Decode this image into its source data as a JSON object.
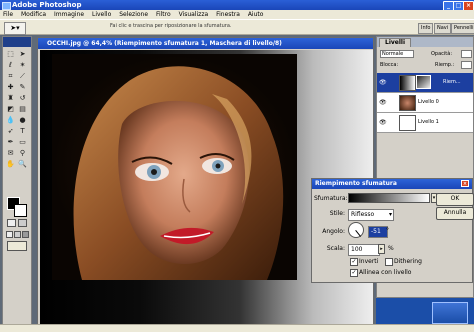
{
  "app": {
    "title": "Adobe Photoshop",
    "menu": [
      "File",
      "Modifica",
      "Immagine",
      "Livello",
      "Selezione",
      "Filtro",
      "Visualizza",
      "Finestra",
      "Aiuto"
    ]
  },
  "options_bar": {
    "hint": "Fai clic e trascina per riposizionare la sfumatura.",
    "palette_tabs": [
      "Info",
      "Navi",
      "Pennelli"
    ]
  },
  "document": {
    "title": "OCCHI.jpg @ 64,4% (Riempimento sfumatura 1, Maschera di livello/8)"
  },
  "layers_panel": {
    "tab": "Livelli",
    "blend_mode": "Normale",
    "opacity_label": "Opacità:",
    "fill_label": "Riemp.:",
    "lock_label": "Blocca:",
    "layers": [
      {
        "name": "Riem...",
        "selected": true
      },
      {
        "name": "Livello 0",
        "selected": false
      },
      {
        "name": "Livello 1",
        "selected": false
      }
    ]
  },
  "gradient_dialog": {
    "title": "Riempimento sfumatura",
    "gradient_label": "Sfumatura:",
    "style_label": "Stile:",
    "style_value": "Riflesso",
    "angle_label": "Angolo:",
    "angle_value": "-51",
    "angle_unit": "°",
    "scale_label": "Scala:",
    "scale_value": "100",
    "scale_unit": "%",
    "invert_label": "Inverti",
    "invert_checked": "✓",
    "dither_label": "Dithering",
    "align_label": "Allinea con livello",
    "align_checked": "✓",
    "ok_label": "OK",
    "cancel_label": "Annulla"
  },
  "colors": {
    "titlebar": "#1a46b8",
    "panel": "#d4d0c8",
    "selected_row": "#1c3fa0"
  }
}
